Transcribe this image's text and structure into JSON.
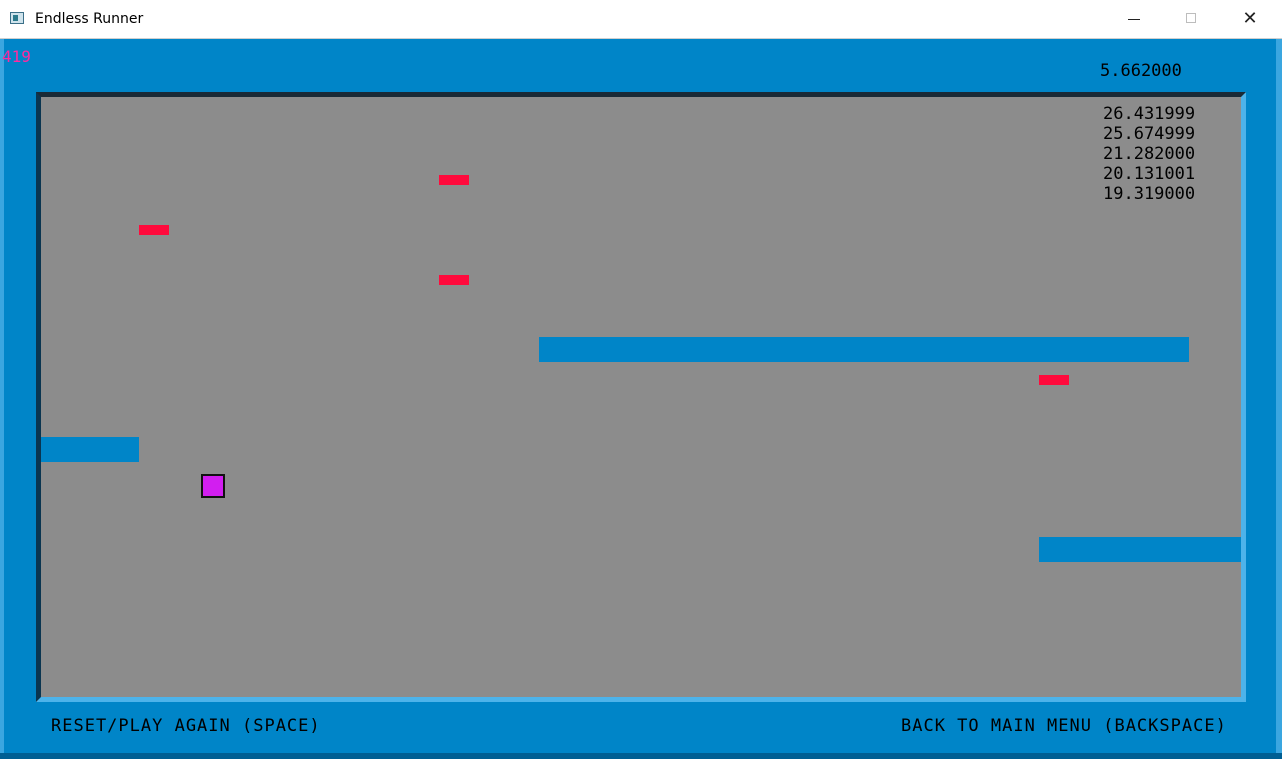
{
  "window": {
    "title": "Endless Runner",
    "minimize_glyph": "",
    "close_glyph": "✕"
  },
  "hud": {
    "fps": "419",
    "current_time": "5.662000",
    "high_scores": [
      "26.431999",
      "25.674999",
      "21.282000",
      "20.131001",
      "19.319000"
    ]
  },
  "footer": {
    "reset_label": "RESET/PLAY AGAIN (SPACE)",
    "menu_label": "BACK TO MAIN MENU (BACKSPACE)"
  },
  "colors": {
    "frame": "#0085c8",
    "playfield": "#8c8c8c",
    "platform": "#0085c8",
    "hazard": "#ff0a3c",
    "player": "#d21ef0",
    "fps_text": "#ff2aa0"
  },
  "icons": {
    "app": "app-window-icon",
    "minimize": "minimize-icon",
    "maximize": "maximize-icon",
    "close": "close-icon"
  }
}
